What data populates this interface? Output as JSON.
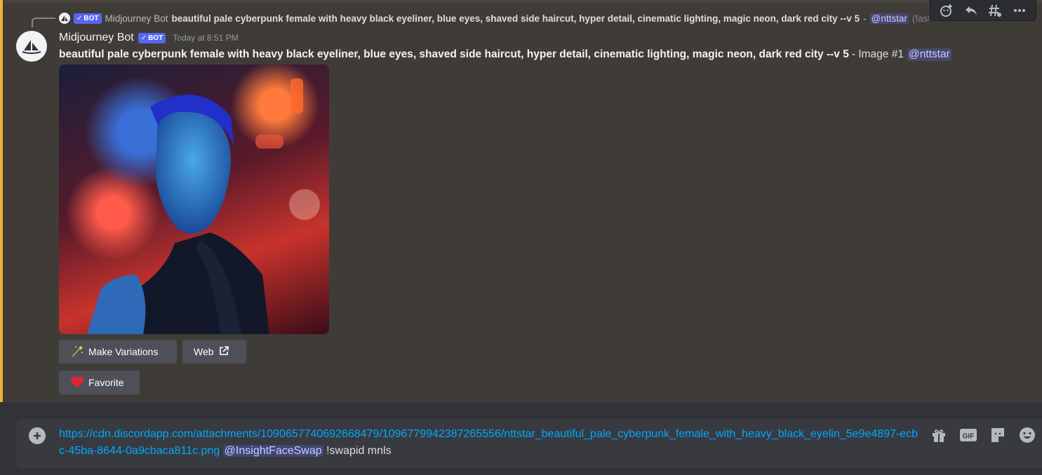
{
  "reply": {
    "author": "Midjourney Bot",
    "bot_tag": "BOT",
    "content": "beautiful pale cyberpunk female with heavy black eyeliner, blue eyes, shaved side haircut, hyper detail, cinematic lighting, magic neon, dark red city --v 5",
    "separator": "-",
    "mention": "@nttstar",
    "trail": "(fast)"
  },
  "message": {
    "author": "Midjourney Bot",
    "bot_tag": "BOT",
    "timestamp": "Today at 8:51 PM",
    "prompt": "beautiful pale cyberpunk female with heavy black eyeliner, blue eyes, shaved side haircut, hyper detail, cinematic lighting, magic neon, dark red city --v 5",
    "suffix": "- Image #1",
    "mention": "@nttstar"
  },
  "buttons": {
    "variations_label": "Make Variations",
    "web_label": "Web",
    "favorite_label": "Favorite"
  },
  "composer": {
    "link": "https://cdn.discordapp.com/attachments/1090657740692668479/1096779942387265556/nttstar_beautiful_pale_cyberpunk_female_with_heavy_black_eyelin_5e9e4897-ecbc-45ba-8644-0a9cbaca811c.png",
    "mention": "@InsightFaceSwap",
    "command": "!swapid mnls",
    "gif_label": "GIF"
  },
  "colors": {
    "highlight_bar": "#f0b232",
    "bot_tag": "#5865f2",
    "link": "#00a8fc",
    "favorite_heart": "#e0243a"
  },
  "icons": [
    "add-reaction-icon",
    "reply-icon",
    "create-thread-icon",
    "more-icon",
    "sparkles-icon",
    "external-link-icon",
    "heart-icon",
    "plus-icon",
    "gift-icon",
    "gif-icon",
    "sticker-icon",
    "emoji-icon"
  ]
}
